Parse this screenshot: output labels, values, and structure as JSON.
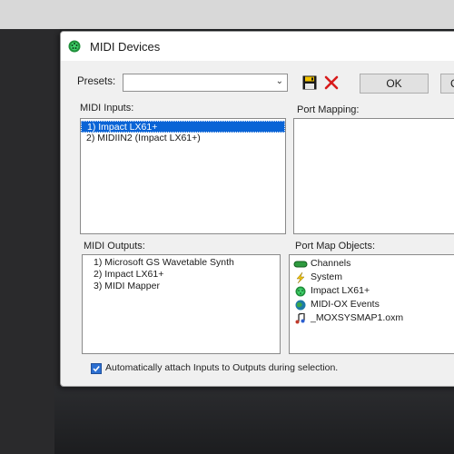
{
  "window": {
    "title": "MIDI Devices"
  },
  "toolbar": {
    "presets_label": "Presets:",
    "presets_value": "",
    "save_icon": "floppy-disk-icon",
    "delete_icon": "red-x-icon",
    "ok_label": "OK",
    "cancel_label_partial": "C"
  },
  "inputs": {
    "label": "MIDI Inputs:",
    "items": [
      {
        "label": "1) Impact LX61+",
        "selected": true
      },
      {
        "label": "2) MIDIIN2 (Impact LX61+)",
        "selected": false
      }
    ]
  },
  "port_mapping": {
    "label": "Port Mapping:"
  },
  "outputs": {
    "label": "MIDI Outputs:",
    "items": [
      {
        "label": "1) Microsoft GS Wavetable Synth"
      },
      {
        "label": "2) Impact LX61+"
      },
      {
        "label": "3) MIDI Mapper"
      }
    ]
  },
  "port_map_objects": {
    "label": "Port Map Objects:",
    "items": [
      {
        "label": "Channels",
        "icon": "channels-icon"
      },
      {
        "label": "System",
        "icon": "lightning-icon"
      },
      {
        "label": "Impact LX61+",
        "icon": "midi-port-icon"
      },
      {
        "label": "MIDI-OX Events",
        "icon": "globe-icon"
      },
      {
        "label": "_MOXSYSMAP1.oxm",
        "icon": "music-note-icon"
      }
    ]
  },
  "auto_attach": {
    "label": "Automatically attach Inputs to Outputs during selection.",
    "checked": true
  },
  "colors": {
    "selection": "#0a64d6",
    "dialog_bg": "#f0f0f0",
    "checkbox": "#2c6fd1"
  }
}
